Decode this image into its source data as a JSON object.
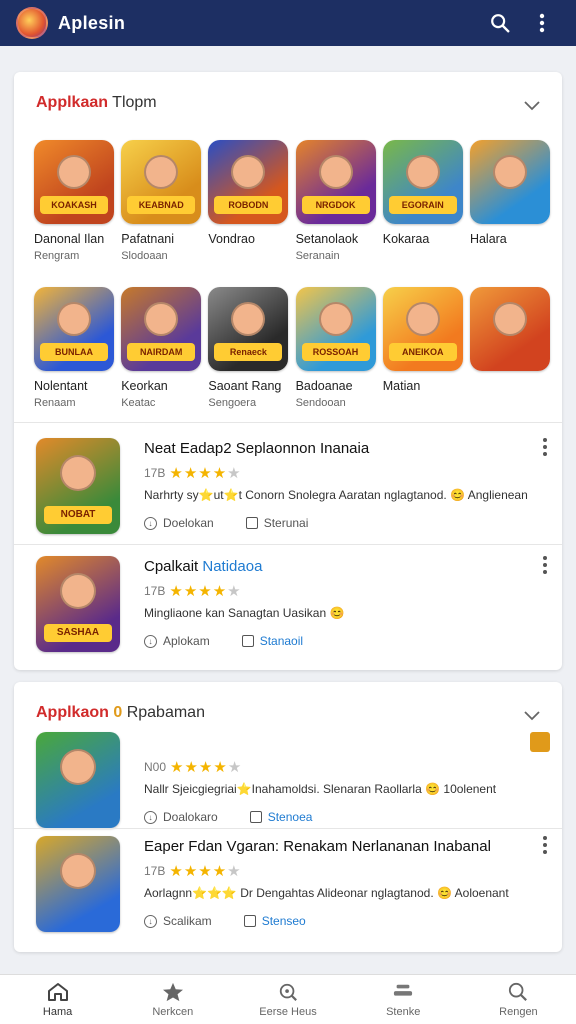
{
  "app": {
    "title": "Aplesin"
  },
  "colors": {
    "topbar": "#1d2f63",
    "accent_red": "#d12b2b",
    "link_blue": "#1f7bd1",
    "star": "#f4b400"
  },
  "section1": {
    "title_red": "Applkaan",
    "title_gray": "Tlopm",
    "row1": [
      {
        "name": "Danonal Ilan",
        "sub": "Rengram",
        "icon_text": "KOAKASH",
        "bg": "#c0441e",
        "bg2": "#f08a2a"
      },
      {
        "name": "Pafatnani",
        "sub": "Slodoaan",
        "icon_text": "KEABNAD",
        "bg": "#d88d1b",
        "bg2": "#f7d04a"
      },
      {
        "name": "Vondrao",
        "sub": "",
        "icon_text": "ROBODN",
        "bg": "#d5571e",
        "bg2": "#2a4ec4"
      },
      {
        "name": "Setanolaok",
        "sub": "Seranain",
        "icon_text": "NRGDOK",
        "bg": "#6a2a9a",
        "bg2": "#e5842a"
      },
      {
        "name": "Kokaraa",
        "sub": "",
        "icon_text": "EGORAIN",
        "bg": "#3e86c9",
        "bg2": "#7ab848"
      },
      {
        "name": "Halara",
        "sub": "",
        "icon_text": "",
        "bg": "#2b8fd6",
        "bg2": "#f3a02c"
      }
    ],
    "row2": [
      {
        "name": "Nolentant",
        "sub": "Renaam",
        "icon_text": "BUNLAA",
        "bg": "#2c58d6",
        "bg2": "#f2b43a"
      },
      {
        "name": "Keorkan",
        "sub": "Keatac",
        "icon_text": "NAIRDAM",
        "bg": "#5a3a9a",
        "bg2": "#c77a2a"
      },
      {
        "name": "Saoant Rang",
        "sub": "Sengoera",
        "icon_text": "Renaeck",
        "bg": "#2a2a2a",
        "bg2": "#8a8a8a"
      },
      {
        "name": "Badoanae",
        "sub": "Sendooan",
        "icon_text": "ROSSOAH",
        "bg": "#2f9ad8",
        "bg2": "#f3c54a"
      },
      {
        "name": "Matian",
        "sub": "",
        "icon_text": "ANEIKOA",
        "bg": "#f27a1f",
        "bg2": "#f7d04a"
      },
      {
        "name": "",
        "sub": "",
        "icon_text": "",
        "bg": "#d2431f",
        "bg2": "#f09a3a"
      }
    ],
    "list": [
      {
        "title": "Neat Eadap2 Seplaonnon Inanaia",
        "title_blue": "",
        "rating_label": "17B",
        "stars": 4,
        "desc_prefix": "Narhrty sy⭐ut⭐t",
        "desc": "Conorn Snolegra Aaratan nglagtanod.",
        "desc_emoji": "😊",
        "desc_suffix": "Anglienean",
        "action1": "Doelokan",
        "action2": "Sterunai",
        "action2_blue": false,
        "thumb_text": "NOBAT",
        "bg": "#3a8a3a",
        "bg2": "#e28a2a"
      },
      {
        "title": "Cpalkait",
        "title_blue": "Natidaoa",
        "rating_label": "17B",
        "stars": 4,
        "desc_prefix": "",
        "desc": "Mingliaone kan Sanagtan Uasikan",
        "desc_emoji": "😊",
        "desc_suffix": "",
        "action1": "Aplokam",
        "action2": "Stanaoil",
        "action2_blue": true,
        "thumb_text": "SASHAA",
        "bg": "#5a2a8a",
        "bg2": "#e28a2a"
      }
    ]
  },
  "section2": {
    "title_red": "Applkaon",
    "title_gray": "Rpabaman",
    "list": [
      {
        "title": "",
        "rating_label": "N00",
        "stars": 4,
        "desc": "Nallr Sjeicgiegriai⭐Inahamoldsi. Slenaran Raollarla",
        "desc_emoji": "😊",
        "desc_suffix": "10olenent",
        "action1": "Doalokaro",
        "action2": "Stenoea",
        "action2_blue": true,
        "bg": "#2a7ac4",
        "bg2": "#4aa83a"
      },
      {
        "title": "Eaper Fdan Vgaran: Renakam Nerlananan Inabanal",
        "rating_label": "17B",
        "stars": 4,
        "desc": "Aorlagnn⭐⭐⭐ Dr Dengahtas Alideonar nglagtanod.",
        "desc_emoji": "😊",
        "desc_suffix": "Aoloenant",
        "action1": "Scalikam",
        "action2": "Stenseo",
        "action2_blue": true,
        "bg": "#2a6ad8",
        "bg2": "#d8a82a"
      }
    ]
  },
  "bottom_nav": [
    {
      "label": "Hama",
      "icon": "home-icon"
    },
    {
      "label": "Nerkcen",
      "icon": "star-icon"
    },
    {
      "label": "Eerse Heus",
      "icon": "search-badge-icon"
    },
    {
      "label": "Stenke",
      "icon": "stack-icon"
    },
    {
      "label": "Rengen",
      "icon": "search-icon"
    }
  ]
}
